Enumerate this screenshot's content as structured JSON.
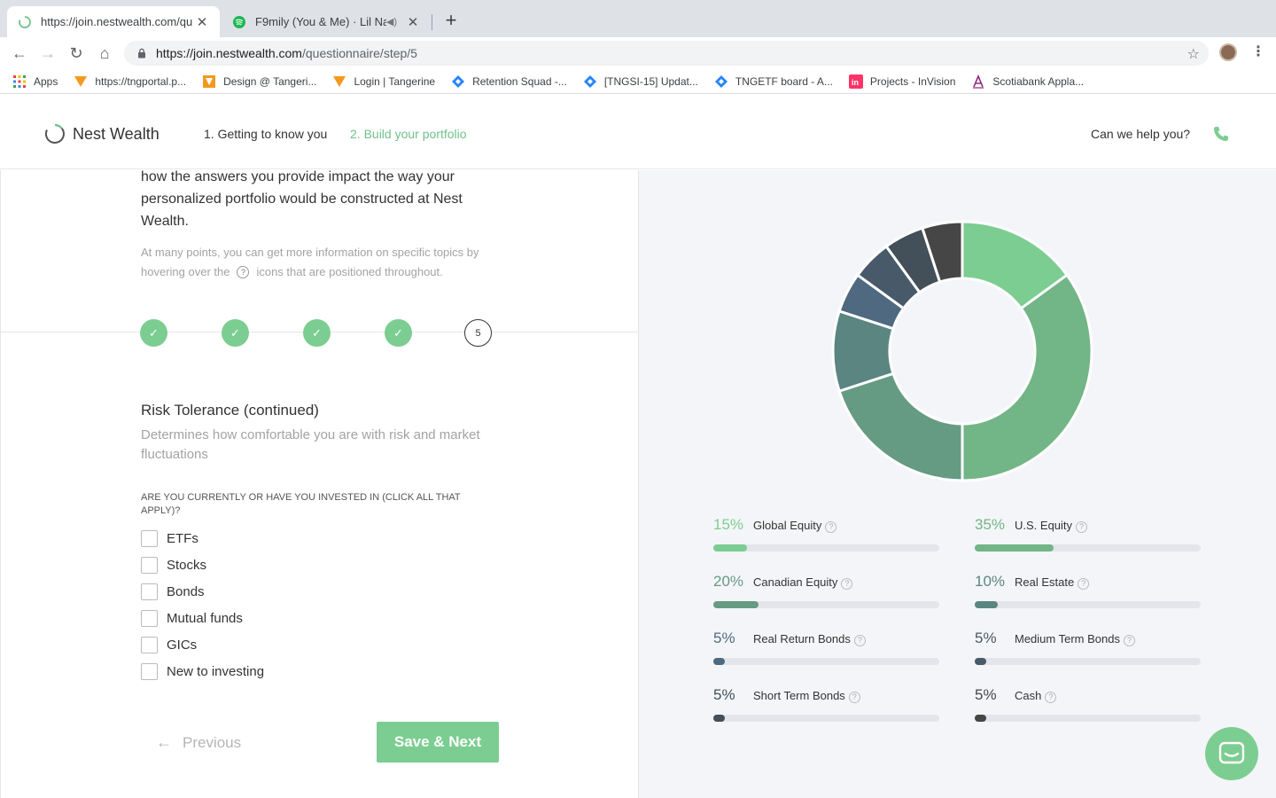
{
  "browser": {
    "tabs": [
      {
        "title": "https://join.nestwealth.com/qu",
        "close": "✕"
      },
      {
        "title": "F9mily (You & Me) · Lil Nas",
        "close": "✕"
      }
    ],
    "url_host": "https://join.nestwealth.com",
    "url_path": "/questionnaire/step/5",
    "bookmarks": [
      {
        "label": "Apps",
        "icon": "apps-grid-icon"
      },
      {
        "label": "https://tngportal.p...",
        "icon": "tangerine-icon"
      },
      {
        "label": "Design @ Tangeri...",
        "icon": "tangerine-icon"
      },
      {
        "label": "Login | Tangerine",
        "icon": "tangerine-icon"
      },
      {
        "label": "Retention Squad -...",
        "icon": "jira-icon"
      },
      {
        "label": "[TNGSI-15] Updat...",
        "icon": "jira-icon"
      },
      {
        "label": "TNGETF board - A...",
        "icon": "jira-icon"
      },
      {
        "label": "Projects - InVision",
        "icon": "invision-icon"
      },
      {
        "label": "Scotiabank Appla...",
        "icon": "scotiabank-icon"
      }
    ]
  },
  "header": {
    "brand": "Nest Wealth",
    "step1": "1. Getting to know you",
    "step2": "2. Build your portfolio",
    "help": "Can we help you?"
  },
  "intro": {
    "text": "how the answers you provide impact the way your personalized portfolio would be constructed at Nest Wealth.",
    "hint_before": "At many points, you can get more information on specific topics by hovering over the",
    "hint_after": "icons that are positioned throughout.",
    "qmark": "?"
  },
  "progress": {
    "completed": 4,
    "current": "5",
    "check": "✓"
  },
  "section": {
    "title": "Risk Tolerance (continued)",
    "subtitle": "Determines how comfortable you are with risk and market fluctuations",
    "question": "ARE YOU CURRENTLY OR HAVE YOU INVESTED IN (CLICK ALL THAT APPLY)?",
    "options": [
      "ETFs",
      "Stocks",
      "Bonds",
      "Mutual funds",
      "GICs",
      "New to investing"
    ]
  },
  "nav": {
    "previous": "Previous",
    "save_next": "Save & Next"
  },
  "allocation": [
    {
      "pct": "15%",
      "name": "Global Equity",
      "value": 15,
      "color": "#7ccd91"
    },
    {
      "pct": "35%",
      "name": "U.S. Equity",
      "value": 35,
      "color": "#72b586"
    },
    {
      "pct": "20%",
      "name": "Canadian Equity",
      "value": 20,
      "color": "#669b83"
    },
    {
      "pct": "10%",
      "name": "Real Estate",
      "value": 10,
      "color": "#5b8581"
    },
    {
      "pct": "5%",
      "name": "Real Return Bonds",
      "value": 5,
      "color": "#4f6a80"
    },
    {
      "pct": "5%",
      "name": "Medium Term Bonds",
      "value": 5,
      "color": "#48596a"
    },
    {
      "pct": "5%",
      "name": "Short Term Bonds",
      "value": 5,
      "color": "#434f59"
    },
    {
      "pct": "5%",
      "name": "Cash",
      "value": 5,
      "color": "#464646"
    }
  ],
  "colors": {
    "brand_green": "#7ccd91",
    "text_muted": "#a3a3a3",
    "pane_bg": "#f4f5f8"
  }
}
